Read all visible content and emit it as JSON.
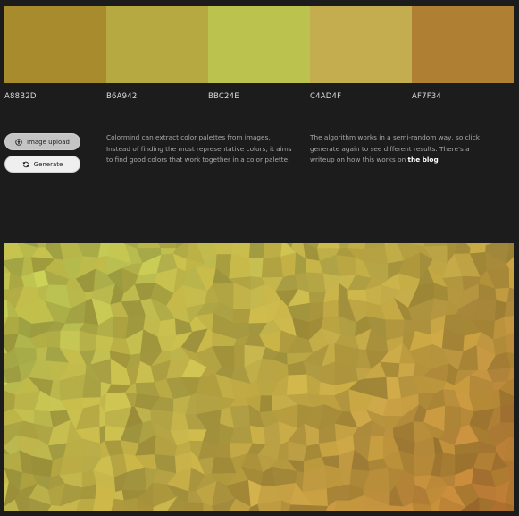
{
  "palette": [
    {
      "hex": "A88B2D",
      "color": "#a88b2d"
    },
    {
      "hex": "B6A942",
      "color": "#b6a942"
    },
    {
      "hex": "BBC24E",
      "color": "#bbc24e"
    },
    {
      "hex": "C4AD4F",
      "color": "#c4ad4f"
    },
    {
      "hex": "AF7F34",
      "color": "#af7f34"
    }
  ],
  "controls": {
    "upload_label": "Image upload",
    "upload_icon": "upload-icon",
    "generate_label": "Generate",
    "generate_icon": "refresh-icon"
  },
  "info": {
    "para1": "Colormind can extract color palettes from images. Instead of finding the most representative colors, it aims to find good colors that work together in a color palette.",
    "para2_text": "The algorithm works in a semi-random way, so click generate again to see different results. There's a writeup on how this works on ",
    "blog_link": "the blog"
  },
  "image": {
    "description_icon": "mosaic-image",
    "colors": [
      "#a88b2d",
      "#b6a942",
      "#bbc24e",
      "#c4ad4f",
      "#af7f34"
    ]
  }
}
